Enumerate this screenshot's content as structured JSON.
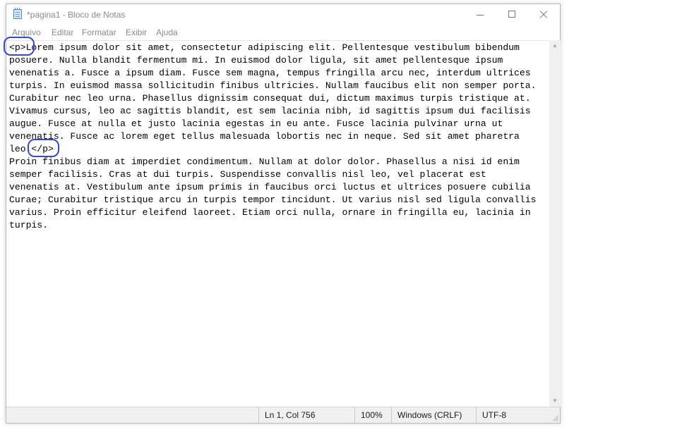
{
  "window": {
    "title": "*pagina1 - Bloco de Notas",
    "controls": {
      "minimize": "minimize-icon",
      "maximize": "maximize-icon",
      "close": "close-icon"
    }
  },
  "menu": {
    "items": [
      {
        "label": "Arquivo"
      },
      {
        "label": "Editar"
      },
      {
        "label": "Formatar"
      },
      {
        "label": "Exibir"
      },
      {
        "label": "Ajuda"
      }
    ]
  },
  "editor": {
    "lines": [
      "<p>Lorem ipsum dolor sit amet, consectetur adipiscing elit. Pellentesque vestibulum bibendum",
      "posuere. Nulla blandit fermentum mi. In euismod dolor ligula, sit amet pellentesque ipsum",
      "venenatis a. Fusce a ipsum diam. Fusce sem magna, tempus fringilla arcu nec, interdum ultrices",
      "turpis. In euismod massa sollicitudin finibus ultricies. Nullam faucibus elit non semper porta.",
      "Curabitur nec leo urna. Phasellus dignissim consequat dui, dictum maximus turpis tristique at.",
      "Vivamus cursus, leo ac sagittis blandit, est sem lacinia nibh, id sagittis ipsum dui facilisis",
      "augue. Fusce at nulla et justo lacinia egestas in eu ante. Fusce lacinia pulvinar urna ut",
      "venenatis. Fusce ac lorem eget tellus malesuada lobortis nec in neque. Sed sit amet pharetra",
      "leo.</p>",
      "Proin finibus diam at imperdiet condimentum. Nullam at dolor dolor. Phasellus a nisi id enim",
      "semper facilisis. Cras at dui turpis. Suspendisse convallis nisl leo, vel placerat est",
      "venenatis at. Vestibulum ante ipsum primis in faucibus orci luctus et ultrices posuere cubilia",
      "Curae; Curabitur tristique arcu in turpis tempor tincidunt. Ut varius nisl sed ligula convallis",
      "varius. Proin efficitur eleifend laoreet. Etiam orci nulla, ornare in fringilla eu, lacinia in",
      "turpis."
    ]
  },
  "status": {
    "position": "Ln 1, Col 756",
    "zoom": "100%",
    "line_ending": "Windows (CRLF)",
    "encoding": "UTF-8"
  },
  "annotations": {
    "color": "#3a4bc2"
  }
}
